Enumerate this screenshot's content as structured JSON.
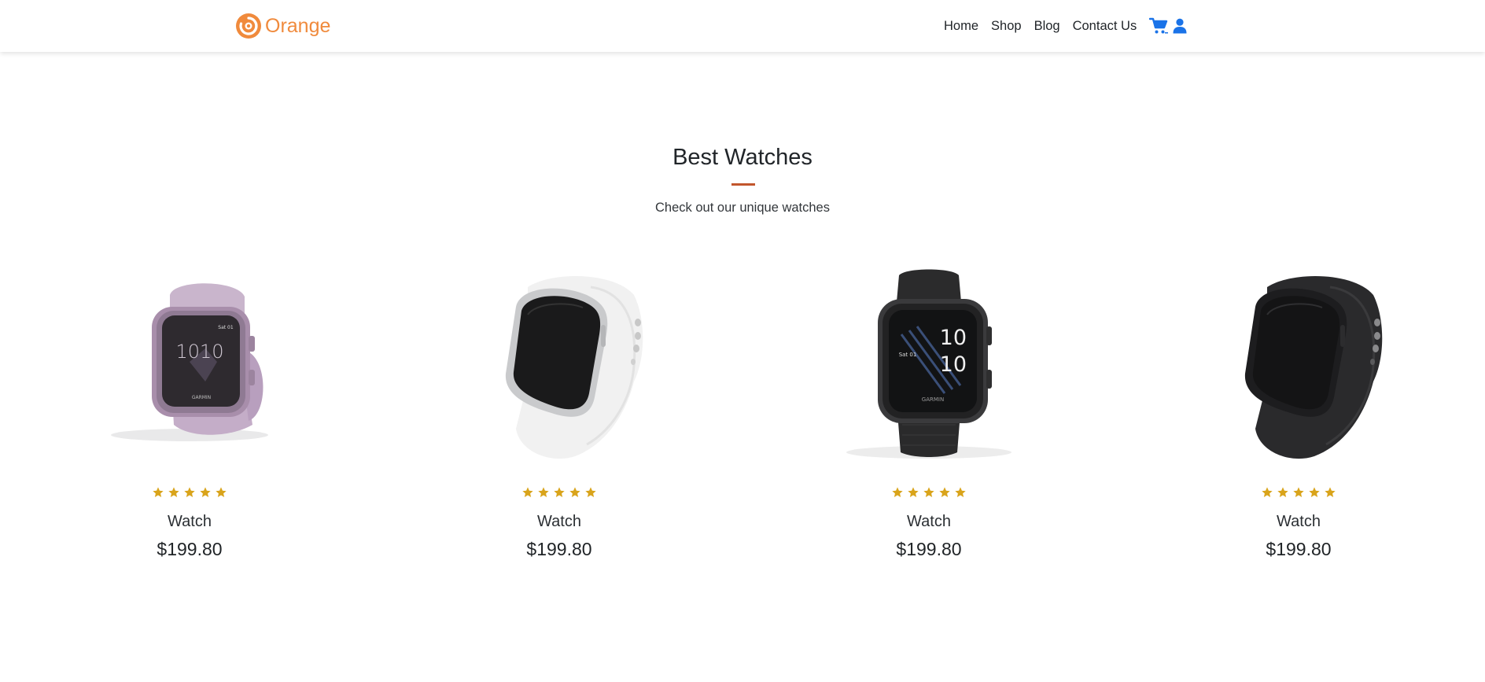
{
  "navbar": {
    "brand_name": "Orange",
    "brand_icon": "orange-swirl-logo",
    "links": [
      {
        "label": "Home"
      },
      {
        "label": "Shop"
      },
      {
        "label": "Blog"
      },
      {
        "label": "Contact Us"
      }
    ],
    "cart_icon": "cart-icon",
    "user_icon": "user-icon",
    "icon_color": "#1a73e8",
    "brand_color": "#f08a3c"
  },
  "section": {
    "title": "Best Watches",
    "subtitle": "Check out our unique watches",
    "accent_color": "#c2562c"
  },
  "products": [
    {
      "name": "Watch",
      "price": "$199.80",
      "rating": 5,
      "image": "lilac-square-smartwatch"
    },
    {
      "name": "Watch",
      "price": "$199.80",
      "rating": 5,
      "image": "white-square-smartwatch"
    },
    {
      "name": "Watch",
      "price": "$199.80",
      "rating": 5,
      "image": "black-square-smartwatch-front"
    },
    {
      "name": "Watch",
      "price": "$199.80",
      "rating": 5,
      "image": "black-square-smartwatch-angled"
    }
  ],
  "star_color": "#d9a41b"
}
